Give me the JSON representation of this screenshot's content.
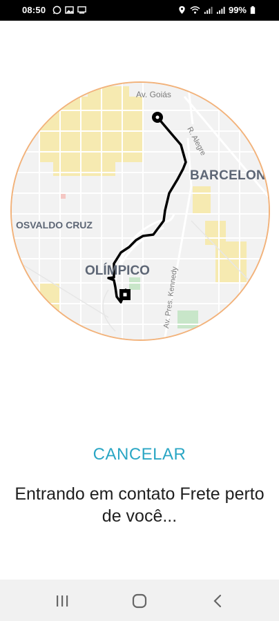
{
  "status_bar": {
    "time": "08:50",
    "battery": "99%",
    "left_icons": [
      "whatsapp-icon",
      "gallery-icon",
      "screen-icon"
    ],
    "right_icons": [
      "location-icon",
      "wifi-icon",
      "signal-icon",
      "signal-icon",
      "battery-icon"
    ]
  },
  "map": {
    "labels": {
      "goias": "Av. Goiás",
      "alegre": "R. Alegre",
      "barcelona": "BARCELON",
      "osvaldo": "OSVALDO CRUZ",
      "olimpico": "OLÍMPICO",
      "kennedy": "Av. Pres. Kennedy"
    },
    "colors": {
      "route": "#000000",
      "border": "#f2b27a",
      "highlight": "#f7e9a6",
      "park": "#c8e6c9"
    }
  },
  "cancel_label": "CANCELAR",
  "status_message": "Entrando em contato Frete perto de você...",
  "nav": {
    "recents_icon": "recents-icon",
    "home_icon": "home-icon",
    "back_icon": "back-icon"
  }
}
